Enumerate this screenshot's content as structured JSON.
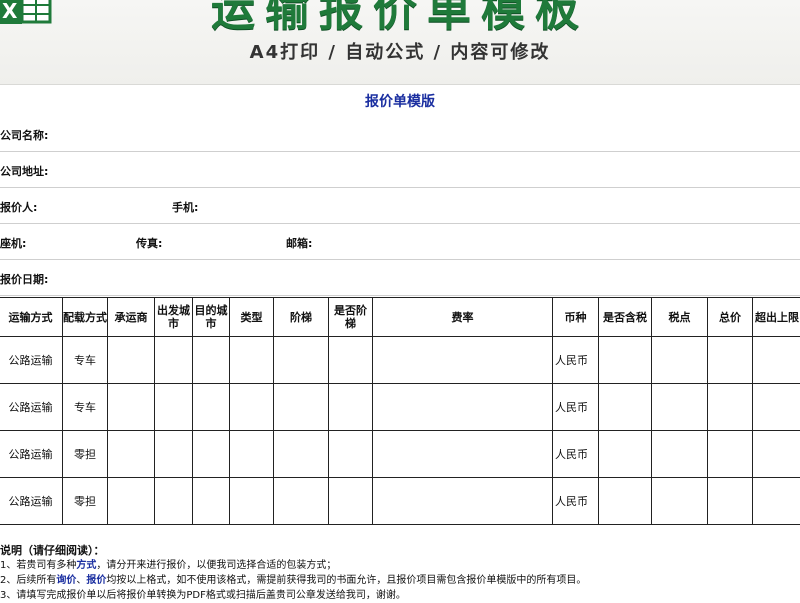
{
  "banner": {
    "title": "运输报价单模板",
    "subtitle": "A4打印 / 自动公式 / 内容可修改"
  },
  "sheet": {
    "title": "报价单模版",
    "company_name_label": "公司名称:",
    "company_address_label": "公司地址:",
    "quoter_label": "报价人:",
    "mobile_label": "手机:",
    "phone_label": "座机:",
    "fax_label": "传真:",
    "email_label": "邮箱:",
    "date_label": "报价日期:"
  },
  "table": {
    "headers": [
      "运输方式",
      "配载方式",
      "承运商",
      "出发城市",
      "目的城市",
      "类型",
      "阶梯",
      "是否阶梯",
      "费率",
      "币种",
      "是否含税",
      "税点",
      "总价",
      "超出上限"
    ],
    "rows": [
      [
        "公路运输",
        "专车",
        "",
        "",
        "",
        "",
        "",
        "",
        "",
        "人民币",
        "",
        "",
        "",
        ""
      ],
      [
        "公路运输",
        "专车",
        "",
        "",
        "",
        "",
        "",
        "",
        "",
        "人民币",
        "",
        "",
        "",
        ""
      ],
      [
        "公路运输",
        "零担",
        "",
        "",
        "",
        "",
        "",
        "",
        "",
        "人民币",
        "",
        "",
        "",
        ""
      ],
      [
        "公路运输",
        "零担",
        "",
        "",
        "",
        "",
        "",
        "",
        "",
        "人民币",
        "",
        "",
        "",
        ""
      ]
    ]
  },
  "notes": {
    "heading": "说明（请仔细阅读）：",
    "line1_pre": "1、若贵司有多种",
    "line1_em": "方式",
    "line1_post": "，请分开来进行报价，以便我司选择合适的包装方式；",
    "line2_pre": "2、后续所有",
    "line2_em1": "询价",
    "line2_sep": "、",
    "line2_em2": "报价",
    "line2_post": "均按以上格式，如不使用该格式，需提前获得我司的书面允许，且报价项目需包含报价单模版中的所有项目。",
    "line3": "3、请填写完成报价单以后将报价单转换为PDF格式或扫描后盖贵司公章发送给我司，谢谢。"
  }
}
